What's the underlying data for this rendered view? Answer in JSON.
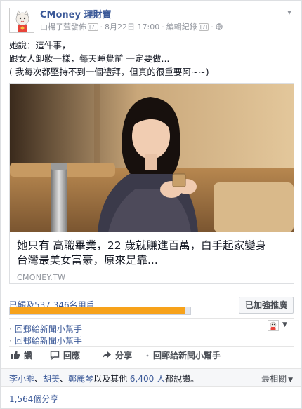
{
  "page": {
    "name": "CMoney 理財寶",
    "published_by": "由楊子萱發佈",
    "date": "8月22日 17:00",
    "edit_history": "編輯紀錄",
    "help_mark": "[?]"
  },
  "post": {
    "lines": [
      "她說：這件事，",
      "跟女人卸妝一樣，每天睡覺前 一定要做...",
      "( 我每次都堅持不到一個禮拜，但真的很重要阿~~)"
    ]
  },
  "link": {
    "title_lines": [
      "她只有 高職畢業，22 歲就賺進百萬，白手起家變身",
      "台灣最美女富豪，原來是靠..."
    ],
    "domain": "CMONEY.TW"
  },
  "reach": {
    "text": "已觸及537,346名用戶",
    "progress_fraction": 0.97,
    "boost_label": "已加強推廣"
  },
  "reply_as": {
    "label_1": "回郵給新聞小幫手",
    "label_2": "回郵給新聞小幫手"
  },
  "actions": {
    "like": "讚",
    "comment": "回應",
    "share": "分享",
    "reply": "回郵給新聞小幫手"
  },
  "likes": {
    "person_1": "李小乖",
    "person_2": "胡美",
    "person_3": "鄭麗琴",
    "connector": "以及其他",
    "others_count": "6,400 人",
    "suffix": "都說讚。",
    "sort_label": "最相關"
  },
  "shares": {
    "count": "1,564個分享"
  },
  "colors": {
    "link_blue": "#3b5998",
    "progress_orange": "#f7a21a",
    "muted_gray": "#90949c"
  }
}
